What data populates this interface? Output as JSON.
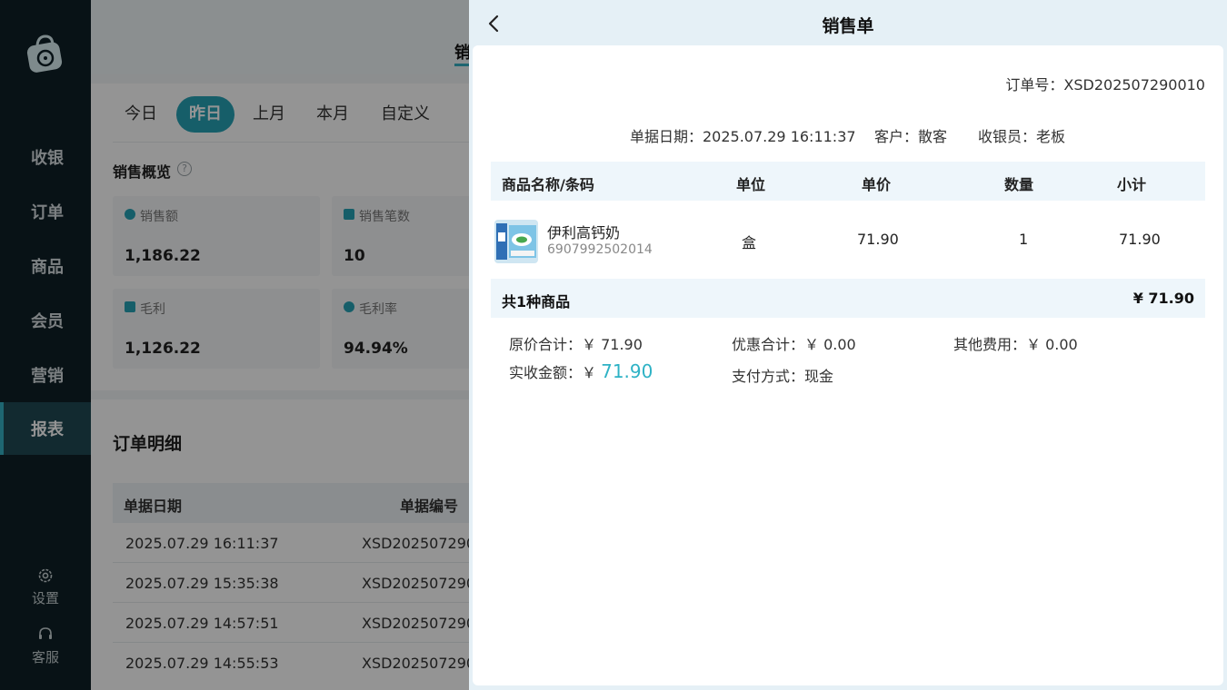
{
  "sidebar": {
    "items": [
      {
        "label": "收银"
      },
      {
        "label": "订单"
      },
      {
        "label": "商品"
      },
      {
        "label": "会员"
      },
      {
        "label": "营销"
      },
      {
        "label": "报表"
      }
    ],
    "active_index": 5,
    "settings_label": "设置",
    "service_label": "客服"
  },
  "main": {
    "tab_peek": "销",
    "date_tabs": [
      "今日",
      "昨日",
      "上月",
      "本月",
      "自定义"
    ],
    "active_date_tab": "昨日",
    "overview_title": "销售概览",
    "cards": [
      {
        "label": "销售额",
        "value": "1,186.22"
      },
      {
        "label": "销售笔数",
        "value": "10"
      },
      {
        "label": "毛利",
        "value": "1,126.22"
      },
      {
        "label": "毛利率",
        "value": "94.94%"
      }
    ],
    "detail_title": "订单明细",
    "table": {
      "headers": [
        "单据日期",
        "单据编号"
      ],
      "rows": [
        [
          "2025.07.29 16:11:37",
          "XSD202507290"
        ],
        [
          "2025.07.29 15:35:38",
          "XSD202507290"
        ],
        [
          "2025.07.29 14:57:51",
          "XSD202507290"
        ],
        [
          "2025.07.29 14:55:53",
          "XSD202507290"
        ]
      ]
    }
  },
  "drawer": {
    "title": "销售单",
    "order_no": "订单号：XSD202507290010",
    "date": "单据日期：2025.07.29 16:11:37",
    "customer": "客户：散客",
    "cashier": "收银员：老板",
    "headers": {
      "name": "商品名称/条码",
      "unit": "单位",
      "price": "单价",
      "qty": "数量",
      "subtotal": "小计"
    },
    "items": [
      {
        "name": "伊利高钙奶",
        "barcode": "6907992502014",
        "unit": "盒",
        "price": "71.90",
        "qty": "1",
        "subtotal": "71.90"
      }
    ],
    "summary_count": "共1种商品",
    "summary_total": "¥  71.90",
    "original_total": "原价合计：￥ 71.90",
    "discount_total": "优惠合计：￥ 0.00",
    "other_fees": "其他费用：￥ 0.00",
    "received_label": "实收金额：￥ ",
    "received_value": "71.90",
    "payment_method": "支付方式：现金"
  },
  "colors": {
    "sidebar_bg": "#0e2027",
    "accent": "#27a3b6",
    "received_amount": "#2eb2c5",
    "drawer_bg": "#e5f0f6",
    "table_header_bg": "#eef6fb"
  },
  "icons": {
    "logo": "bag-logo-icon",
    "settings": "gear-icon",
    "service": "headset-icon",
    "help": "question-circle-icon",
    "back": "chevron-left-icon"
  }
}
